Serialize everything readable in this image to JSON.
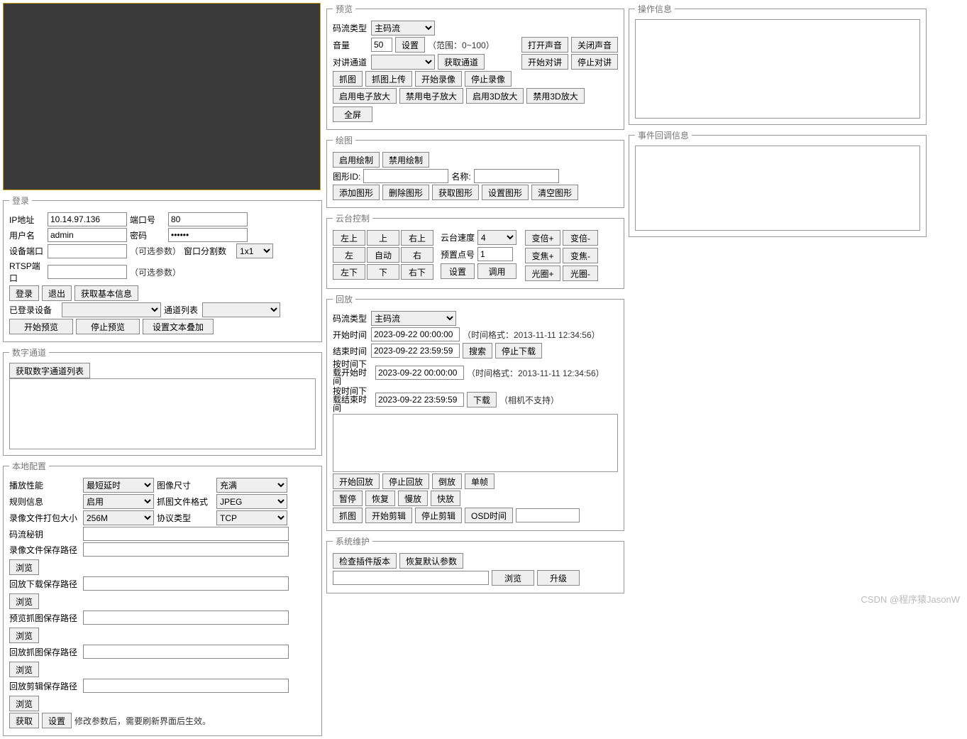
{
  "login": {
    "legend": "登录",
    "ip_label": "IP地址",
    "ip": "10.14.97.136",
    "port_label": "端口号",
    "port": "80",
    "user_label": "用户名",
    "user": "admin",
    "pwd_label": "密码",
    "pwd": "••••••",
    "devport_label": "设备端口",
    "devport": "",
    "opt_hint": "（可选参数）",
    "rtsp_label": "RTSP端口",
    "rtsp": "",
    "split_label": "窗口分割数",
    "split": "1x1",
    "btn_login": "登录",
    "btn_logout": "退出",
    "btn_info": "获取基本信息",
    "logged_label": "已登录设备",
    "chan_label": "通道列表",
    "btn_start_preview": "开始预览",
    "btn_stop_preview": "停止预览",
    "btn_osd": "设置文本叠加"
  },
  "digital": {
    "legend": "数字通道",
    "btn": "获取数字通道列表"
  },
  "local": {
    "legend": "本地配置",
    "perf_label": "播放性能",
    "perf": "最短延时",
    "size_label": "图像尺寸",
    "size": "充满",
    "rule_label": "规则信息",
    "rule": "启用",
    "snapfmt_label": "抓图文件格式",
    "snapfmt": "JPEG",
    "pack_label": "录像文件打包大小",
    "pack": "256M",
    "proto_label": "协议类型",
    "proto": "TCP",
    "key_label": "码流秘钥",
    "path1_label": "录像文件保存路径",
    "path2_label": "回放下载保存路径",
    "path3_label": "预览抓图保存路径",
    "path4_label": "回放抓图保存路径",
    "path5_label": "回放剪辑保存路径",
    "browse": "浏览",
    "btn_get": "获取",
    "btn_set": "设置",
    "note": "修改参数后，需要刷新界面后生效。"
  },
  "preview": {
    "legend": "预览",
    "stream_label": "码流类型",
    "stream": "主码流",
    "vol_label": "音量",
    "vol": "50",
    "btn_setvol": "设置",
    "vol_hint": "（范围：0~100）",
    "btn_open_sound": "打开声音",
    "btn_close_sound": "关闭声音",
    "talk_label": "对讲通道",
    "btn_get_chan": "获取通道",
    "btn_start_talk": "开始对讲",
    "btn_stop_talk": "停止对讲",
    "btn_snap": "抓图",
    "btn_snap_upload": "抓图上传",
    "btn_start_rec": "开始录像",
    "btn_stop_rec": "停止录像",
    "btn_ezoom_on": "启用电子放大",
    "btn_ezoom_off": "禁用电子放大",
    "btn_3d_on": "启用3D放大",
    "btn_3d_off": "禁用3D放大",
    "btn_full": "全屏"
  },
  "draw": {
    "legend": "绘图",
    "btn_enable": "启用绘制",
    "btn_disable": "禁用绘制",
    "id_label": "图形ID:",
    "name_label": "名称:",
    "btn_add": "添加图形",
    "btn_del": "删除图形",
    "btn_get": "获取图形",
    "btn_set": "设置图形",
    "btn_clear": "清空图形"
  },
  "ptz": {
    "legend": "云台控制",
    "lu": "左上",
    "u": "上",
    "ru": "右上",
    "l": "左",
    "auto": "自动",
    "r": "右",
    "ld": "左下",
    "d": "下",
    "rd": "右下",
    "speed_label": "云台速度",
    "speed": "4",
    "preset_label": "预置点号",
    "preset": "1",
    "btn_set": "设置",
    "btn_call": "调用",
    "zoom_in": "变倍+",
    "zoom_out": "变倍-",
    "focus_in": "变焦+",
    "focus_out": "变焦-",
    "iris_in": "光圈+",
    "iris_out": "光圈-"
  },
  "playback": {
    "legend": "回放",
    "stream_label": "码流类型",
    "stream": "主码流",
    "start_label": "开始时间",
    "start": "2023-09-22 00:00:00",
    "end_label": "结束时间",
    "end": "2023-09-22 23:59:59",
    "fmt_hint": "（时间格式：2013-11-11 12:34:56）",
    "btn_search": "搜索",
    "btn_stop_dl": "停止下载",
    "dl_start_label": "按时间下载开始时间",
    "dl_start": "2023-09-22 00:00:00",
    "dl_end_label": "按时间下载结束时间",
    "dl_end": "2023-09-22 23:59:59",
    "btn_dl": "下载",
    "ns_hint": "（相机不支持）",
    "btn_play": "开始回放",
    "btn_stop": "停止回放",
    "btn_rev": "倒放",
    "btn_frame": "单帧",
    "btn_pause": "暂停",
    "btn_resume": "恢复",
    "btn_slow": "慢放",
    "btn_fast": "快放",
    "btn_snap": "抓图",
    "btn_clip_start": "开始剪辑",
    "btn_clip_stop": "停止剪辑",
    "btn_osd": "OSD时间"
  },
  "maint": {
    "legend": "系统维护",
    "btn_check": "检查插件版本",
    "btn_restore": "恢复默认参数",
    "btn_browse": "浏览",
    "btn_upgrade": "升级"
  },
  "opinfo": {
    "legend": "操作信息"
  },
  "evinfo": {
    "legend": "事件回调信息"
  },
  "watermark": "CSDN @程序猿JasonW"
}
